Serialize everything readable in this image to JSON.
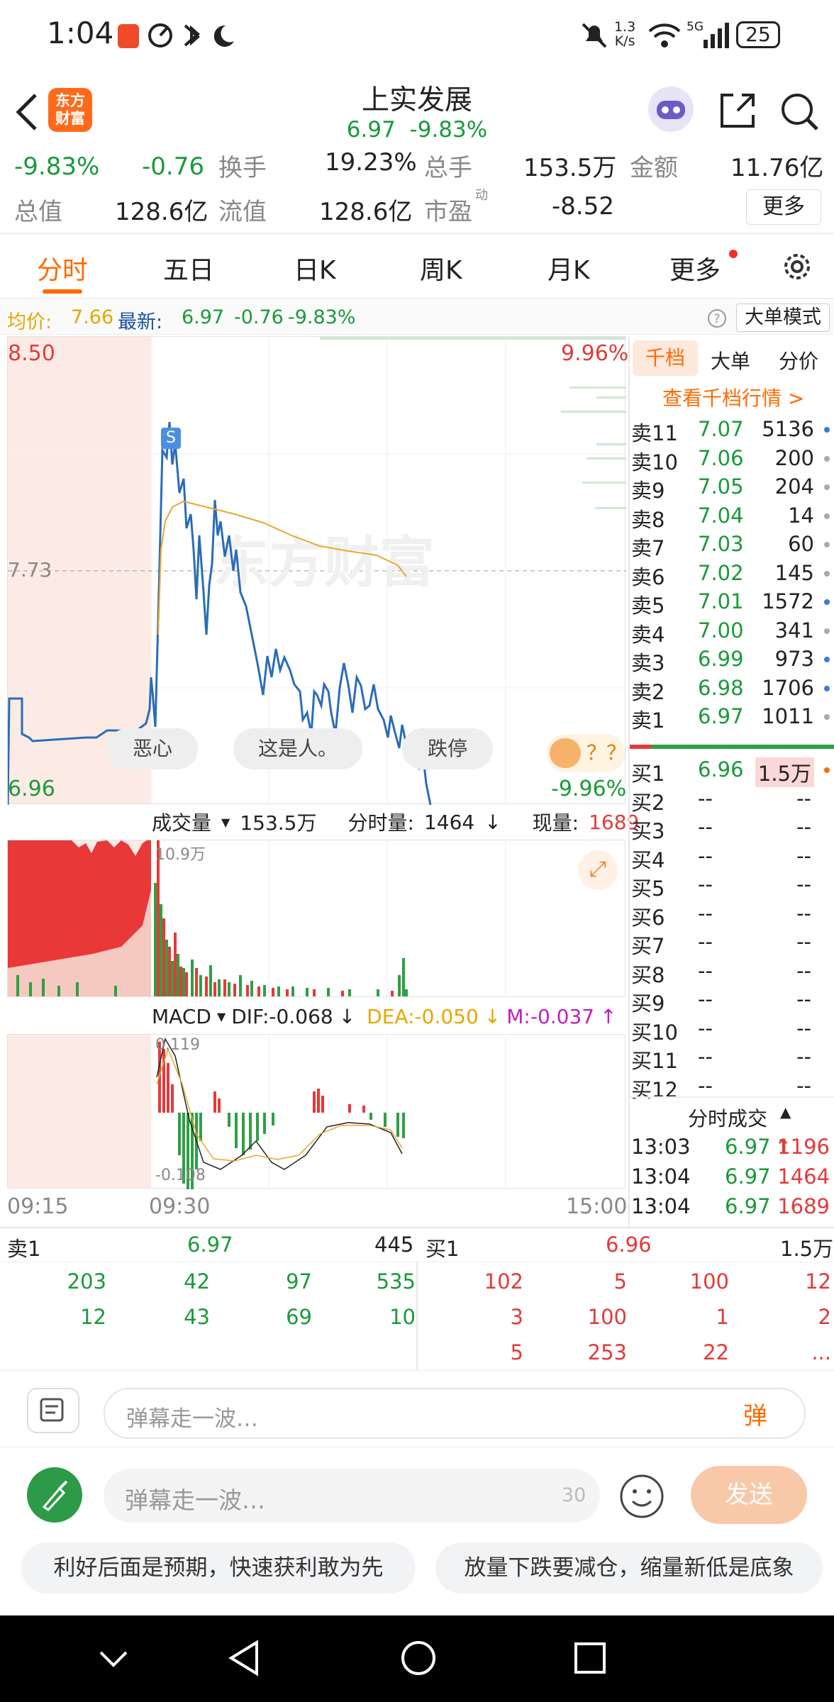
{
  "status_bar": {
    "time": "1:04",
    "net_speed_top": "1.3",
    "net_speed_bottom": "K/s",
    "network": "5G",
    "battery": "25"
  },
  "header": {
    "title": "上实发展",
    "price": "6.97",
    "change_pct": "-9.83%",
    "logo_text_1": "东方",
    "logo_text_2": "财富"
  },
  "metrics": {
    "change_pct": "-9.83%",
    "change_amt": "-0.76",
    "turnover_label": "换手",
    "turnover_value": "19.23%",
    "total_vol_label": "总手",
    "total_vol_value": "153.5万",
    "amount_label": "金额",
    "amount_value": "11.76亿",
    "total_cap_label": "总值",
    "total_cap_value": "128.6亿",
    "float_cap_label": "流值",
    "float_cap_value": "128.6亿",
    "pe_label": "市盈",
    "pe_sup": "动",
    "pe_value": "-8.52",
    "more_button": "更多"
  },
  "tabs": {
    "t1": "分时",
    "t2": "五日",
    "t3": "日K",
    "t4": "周K",
    "t5": "月K",
    "t6": "更多"
  },
  "avg_line": {
    "avg_label": "均价:",
    "avg_value": "7.66",
    "latest_label": "最新:",
    "latest_value": "6.97",
    "chg": "-0.76",
    "pct": "-9.83%",
    "mode_button": "大单模式"
  },
  "price_chart": {
    "high": "8.50",
    "low": "6.96",
    "mid": "7.73",
    "pct_high": "9.96%",
    "pct_low": "-9.96%",
    "s_marker": "S",
    "watermark": "东方财富"
  },
  "danmaku_pills": {
    "p1": "恶心",
    "p2": "这是人。",
    "p3": "跌停",
    "p4": "？？"
  },
  "volume_bar": {
    "label": "成交量",
    "total": "153.5万",
    "minute_label": "分时量:",
    "minute_value": "1464",
    "current_label": "现量:",
    "current_value": "1689",
    "max_label": "10.9万"
  },
  "macd_bar": {
    "label": "MACD",
    "dif": "DIF:-0.068",
    "dea": "DEA:-0.050",
    "m": "M:-0.037",
    "max_label": "0.119",
    "min_label": "-0.108"
  },
  "time_axis": {
    "t1": "09:15",
    "t2": "09:30",
    "t3": "15:00"
  },
  "orderbook": {
    "tabs": {
      "a": "千档",
      "b": "大单",
      "c": "分价"
    },
    "link": "查看千档行情 >",
    "asks": [
      {
        "label": "卖11",
        "price": "7.07",
        "vol": "5136"
      },
      {
        "label": "卖10",
        "price": "7.06",
        "vol": "200"
      },
      {
        "label": "卖9",
        "price": "7.05",
        "vol": "204"
      },
      {
        "label": "卖8",
        "price": "7.04",
        "vol": "14"
      },
      {
        "label": "卖7",
        "price": "7.03",
        "vol": "60"
      },
      {
        "label": "卖6",
        "price": "7.02",
        "vol": "145"
      },
      {
        "label": "卖5",
        "price": "7.01",
        "vol": "1572"
      },
      {
        "label": "卖4",
        "price": "7.00",
        "vol": "341"
      },
      {
        "label": "卖3",
        "price": "6.99",
        "vol": "973"
      },
      {
        "label": "卖2",
        "price": "6.98",
        "vol": "1706"
      },
      {
        "label": "卖1",
        "price": "6.97",
        "vol": "1011"
      }
    ],
    "bids": [
      {
        "label": "买1",
        "price": "6.96",
        "vol": "1.5万"
      },
      {
        "label": "买2",
        "price": "--",
        "vol": "--"
      },
      {
        "label": "买3",
        "price": "--",
        "vol": "--"
      },
      {
        "label": "买4",
        "price": "--",
        "vol": "--"
      },
      {
        "label": "买5",
        "price": "--",
        "vol": "--"
      },
      {
        "label": "买6",
        "price": "--",
        "vol": "--"
      },
      {
        "label": "买7",
        "price": "--",
        "vol": "--"
      },
      {
        "label": "买8",
        "price": "--",
        "vol": "--"
      },
      {
        "label": "买9",
        "price": "--",
        "vol": "--"
      },
      {
        "label": "买10",
        "price": "--",
        "vol": "--"
      },
      {
        "label": "买11",
        "price": "--",
        "vol": "--"
      },
      {
        "label": "买12",
        "price": "--",
        "vol": "--"
      }
    ],
    "ticks_title": "分时成交",
    "ticks": [
      {
        "time": "13:03",
        "price": "6.97",
        "vol": "1196"
      },
      {
        "time": "13:04",
        "price": "6.97",
        "vol": "1464"
      },
      {
        "time": "13:04",
        "price": "6.97",
        "vol": "1689"
      }
    ]
  },
  "queue": {
    "ask_label": "卖1",
    "ask_price": "6.97",
    "ask_total": "445",
    "bid_label": "买1",
    "bid_price": "6.96",
    "bid_total": "1.5万",
    "ask_orders": [
      "203",
      "42",
      "97",
      "535",
      "12",
      "43",
      "69",
      "10"
    ],
    "bid_orders": [
      "102",
      "5",
      "100",
      "12",
      "3",
      "100",
      "1",
      "2",
      "5",
      "253",
      "22",
      "..."
    ]
  },
  "danmaku_input": {
    "placeholder": "弹幕走一波…",
    "toggle": "弹"
  },
  "compose": {
    "placeholder": "弹幕走一波…",
    "counter": "30",
    "send": "发送"
  },
  "suggestions": {
    "s1": "利好后面是预期，快速获利敢为先",
    "s2": "放量下跌要减仓，缩量新低是底象"
  }
}
